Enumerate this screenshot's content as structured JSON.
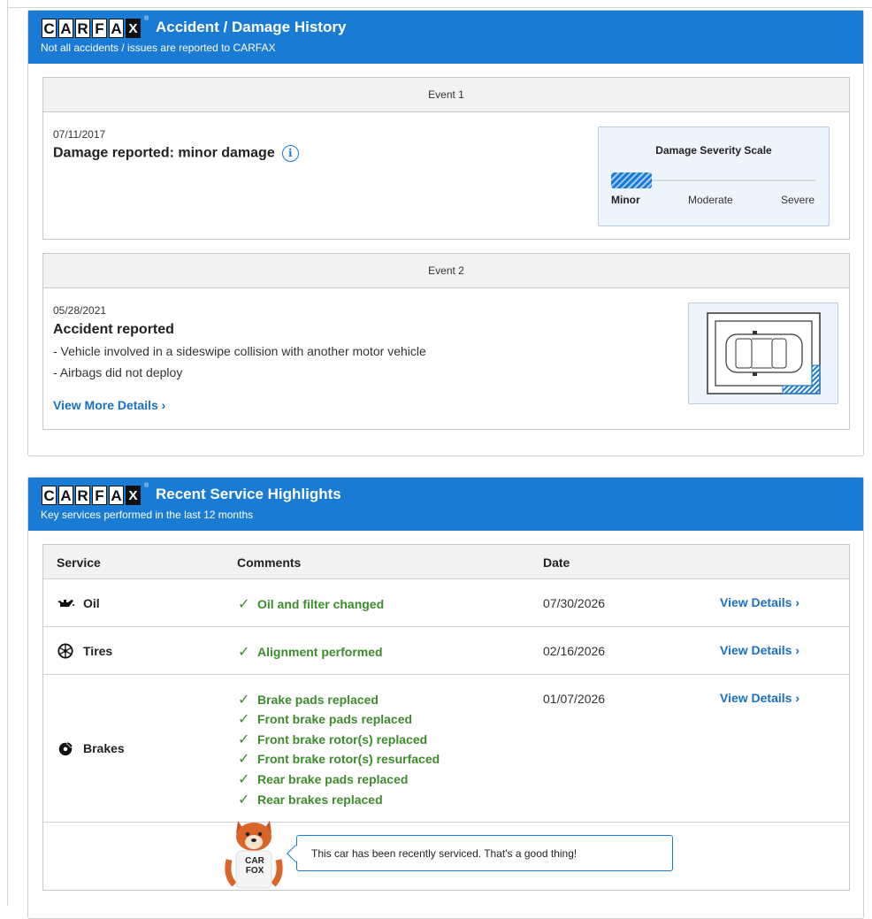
{
  "logo": {
    "letters": [
      "C",
      "A",
      "R",
      "F",
      "A",
      "X"
    ],
    "tm": "®"
  },
  "accident_panel": {
    "title": "Accident / Damage History",
    "subtitle": "Not all accidents / issues are reported to CARFAX",
    "event1": {
      "header": "Event 1",
      "date": "07/11/2017",
      "title": "Damage reported: minor damage",
      "info_icon": "info-icon",
      "severity": {
        "title": "Damage Severity Scale",
        "labels": [
          "Minor",
          "Moderate",
          "Severe"
        ],
        "level": "Minor",
        "fill_fraction": 0.2
      }
    },
    "event2": {
      "header": "Event 2",
      "date": "05/28/2021",
      "title": "Accident reported",
      "details": [
        "- Vehicle involved in a sideswipe collision with another motor vehicle",
        "- Airbags did not deploy"
      ],
      "link": "View More Details ›",
      "diagram_icon": "car-damage-diagram-icon"
    }
  },
  "service_panel": {
    "title": "Recent Service Highlights",
    "subtitle": "Key services performed in the last 12 months",
    "columns": [
      "Service",
      "Comments",
      "Date"
    ],
    "rows": [
      {
        "service": "Oil",
        "icon": "oil-can-icon",
        "comments": [
          "Oil and filter changed"
        ],
        "date": "07/30/2026",
        "link": "View Details ›"
      },
      {
        "service": "Tires",
        "icon": "tire-icon",
        "comments": [
          "Alignment performed"
        ],
        "date": "02/16/2026",
        "link": "View Details ›"
      },
      {
        "service": "Brakes",
        "icon": "brake-disc-icon",
        "comments": [
          "Brake pads replaced",
          "Front brake pads replaced",
          "Front brake rotor(s) replaced",
          "Front brake rotor(s) resurfaced",
          "Rear brake pads replaced",
          "Rear brakes replaced"
        ],
        "date": "01/07/2026",
        "link": "View Details ›"
      }
    ],
    "mascot_shirt": [
      "CAR",
      "FOX"
    ],
    "message": "This car has been recently serviced. That's a good thing!"
  },
  "colors": {
    "brand_blue": "#1a7bd4",
    "link_blue": "#1a6fc4",
    "check_green": "#3c8c2c"
  }
}
